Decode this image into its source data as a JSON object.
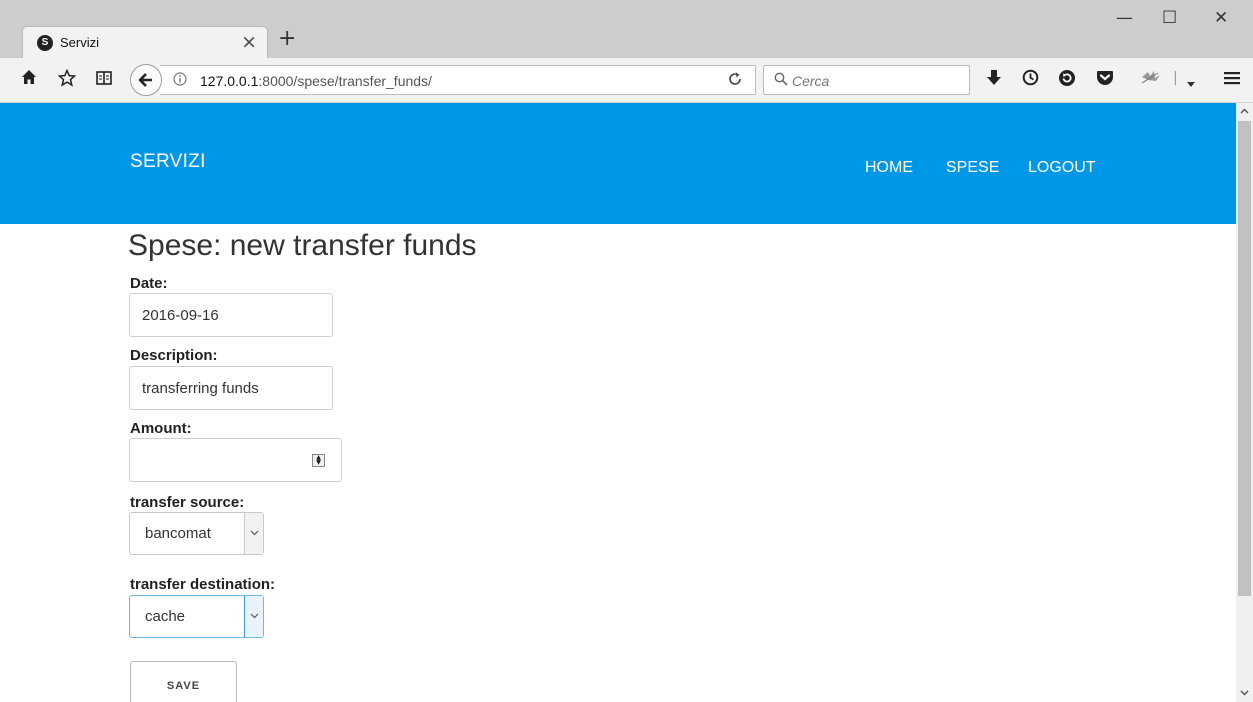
{
  "browser": {
    "tab_title": "Servizi",
    "tab_favicon_letter": "S",
    "new_tab": "+",
    "tab_close": "×",
    "url_host": "127.0.0.1",
    "url_rest": ":8000/spese/transfer_funds/",
    "search_placeholder": "Cerca",
    "window_controls": {
      "minimize": "—",
      "maximize": "☐",
      "close": "✕"
    }
  },
  "site": {
    "brand": "SERVIZI",
    "menu": [
      "HOME",
      "SPESE",
      "LOGOUT"
    ]
  },
  "form": {
    "title": "Spese: new transfer funds",
    "date_label": "Date:",
    "date_value": "2016-09-16",
    "description_label": "Description:",
    "description_value": "transferring funds",
    "amount_label": "Amount:",
    "amount_value": "",
    "source_label": "transfer source:",
    "source_value": "bancomat",
    "destination_label": "transfer destination:",
    "destination_value": "cache",
    "save_label": "SAVE"
  },
  "icons": {
    "home": "home-icon",
    "bookmark": "star-icon",
    "reader": "reader-icon",
    "back": "back-arrow-icon",
    "info": "info-icon",
    "reload": "reload-icon",
    "search": "search-icon",
    "download": "download-icon",
    "history": "history-icon",
    "sync": "sync-icon",
    "pocket": "pocket-icon",
    "extension": "extension-icon",
    "menu": "hamburger-menu-icon"
  }
}
